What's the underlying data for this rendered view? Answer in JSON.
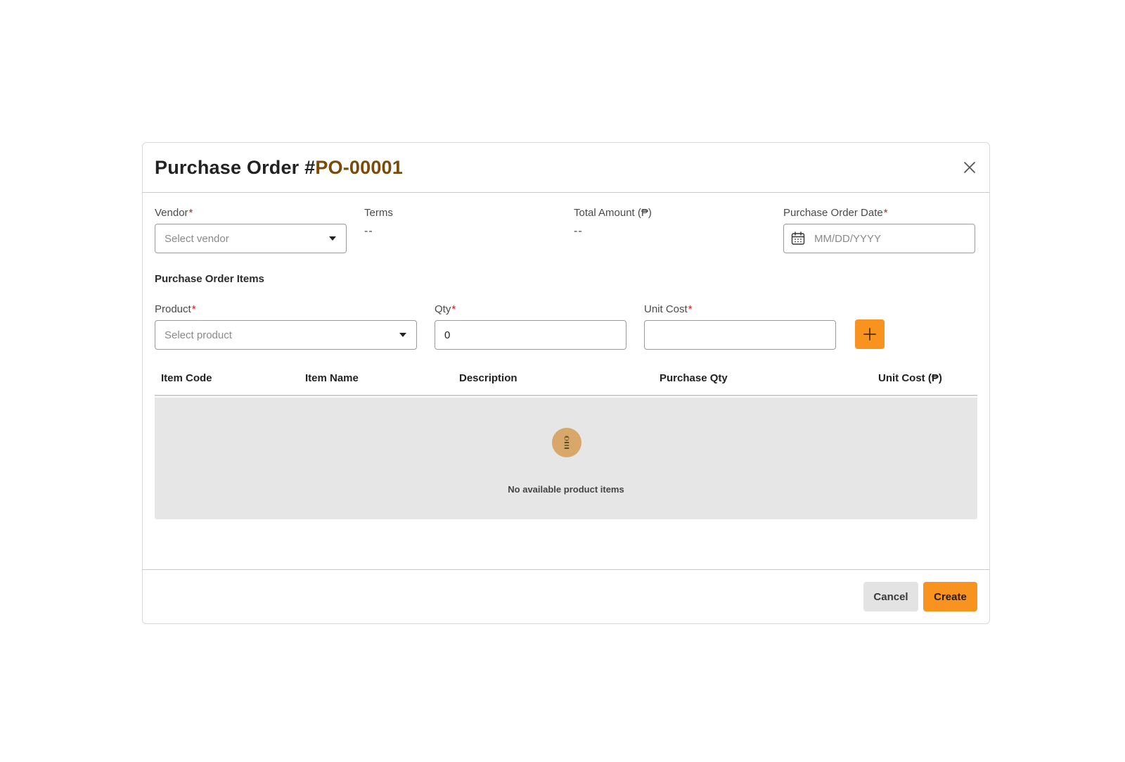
{
  "modal": {
    "title_prefix": "Purchase Order #",
    "po_number": "PO-00001"
  },
  "form": {
    "vendor": {
      "label": "Vendor",
      "required_mark": "*",
      "placeholder": "Select vendor"
    },
    "terms": {
      "label": "Terms",
      "value": "--"
    },
    "total_amount": {
      "label": "Total Amount (₱)",
      "value": "--"
    },
    "po_date": {
      "label": "Purchase Order Date",
      "required_mark": "*",
      "placeholder": "MM/DD/YYYY"
    }
  },
  "items_section": {
    "title": "Purchase Order Items",
    "product": {
      "label": "Product",
      "required_mark": "*",
      "placeholder": "Select product"
    },
    "qty": {
      "label": "Qty",
      "required_mark": "*",
      "value": "0"
    },
    "unit_cost": {
      "label": "Unit Cost",
      "required_mark": "*",
      "value": ""
    }
  },
  "table": {
    "columns": [
      "Item Code",
      "Item Name",
      "Description",
      "Purchase Qty",
      "Unit Cost (₱)"
    ],
    "empty_message": "No available product items"
  },
  "footer": {
    "cancel_label": "Cancel",
    "create_label": "Create"
  },
  "colors": {
    "accent": "#f7931e",
    "po_number": "#7a4a08",
    "required": "#d11a1a"
  },
  "icons": {
    "close": "close-icon",
    "dropdown": "chevron-down-icon",
    "calendar": "calendar-icon",
    "add": "plus-icon",
    "empty": "empty-box-icon"
  }
}
